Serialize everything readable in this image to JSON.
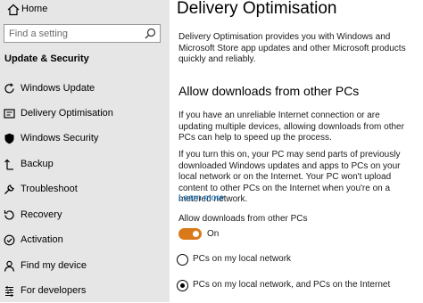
{
  "sidebar": {
    "home_label": "Home",
    "search_placeholder": "Find a setting",
    "section_title": "Update & Security",
    "items": [
      {
        "label": "Windows Update",
        "icon": "sync-icon"
      },
      {
        "label": "Delivery Optimisation",
        "icon": "delivery-icon"
      },
      {
        "label": "Windows Security",
        "icon": "shield-icon"
      },
      {
        "label": "Backup",
        "icon": "backup-arrow-icon"
      },
      {
        "label": "Troubleshoot",
        "icon": "wrench-icon"
      },
      {
        "label": "Recovery",
        "icon": "recovery-icon"
      },
      {
        "label": "Activation",
        "icon": "check-circle-icon"
      },
      {
        "label": "Find my device",
        "icon": "person-location-icon"
      },
      {
        "label": "For developers",
        "icon": "developer-bars-icon"
      }
    ]
  },
  "main": {
    "title": "Delivery Optimisation",
    "intro": "Delivery Optimisation provides you with Windows and Microsoft Store app updates and other Microsoft products quickly and reliably.",
    "subheading": "Allow downloads from other PCs",
    "para1": "If you have an unreliable Internet connection or are updating multiple devices, allowing downloads from other PCs can help to speed up the process.",
    "para2": "If you turn this on, your PC may send parts of previously downloaded Windows updates and apps to PCs on your local network or on the Internet. Your PC won't upload content to other PCs on the Internet when you're on a metered network.",
    "learn_more": "Learn more",
    "toggle_label": "Allow downloads from other PCs",
    "toggle_state": "On",
    "radio_options": [
      {
        "label": "PCs on my local network",
        "checked": false
      },
      {
        "label": "PCs on my local network, and PCs on the Internet",
        "checked": true
      }
    ]
  },
  "colors": {
    "accent": "#d9791a",
    "link": "#0063b1",
    "sidebar_bg": "#e6e6e6"
  }
}
